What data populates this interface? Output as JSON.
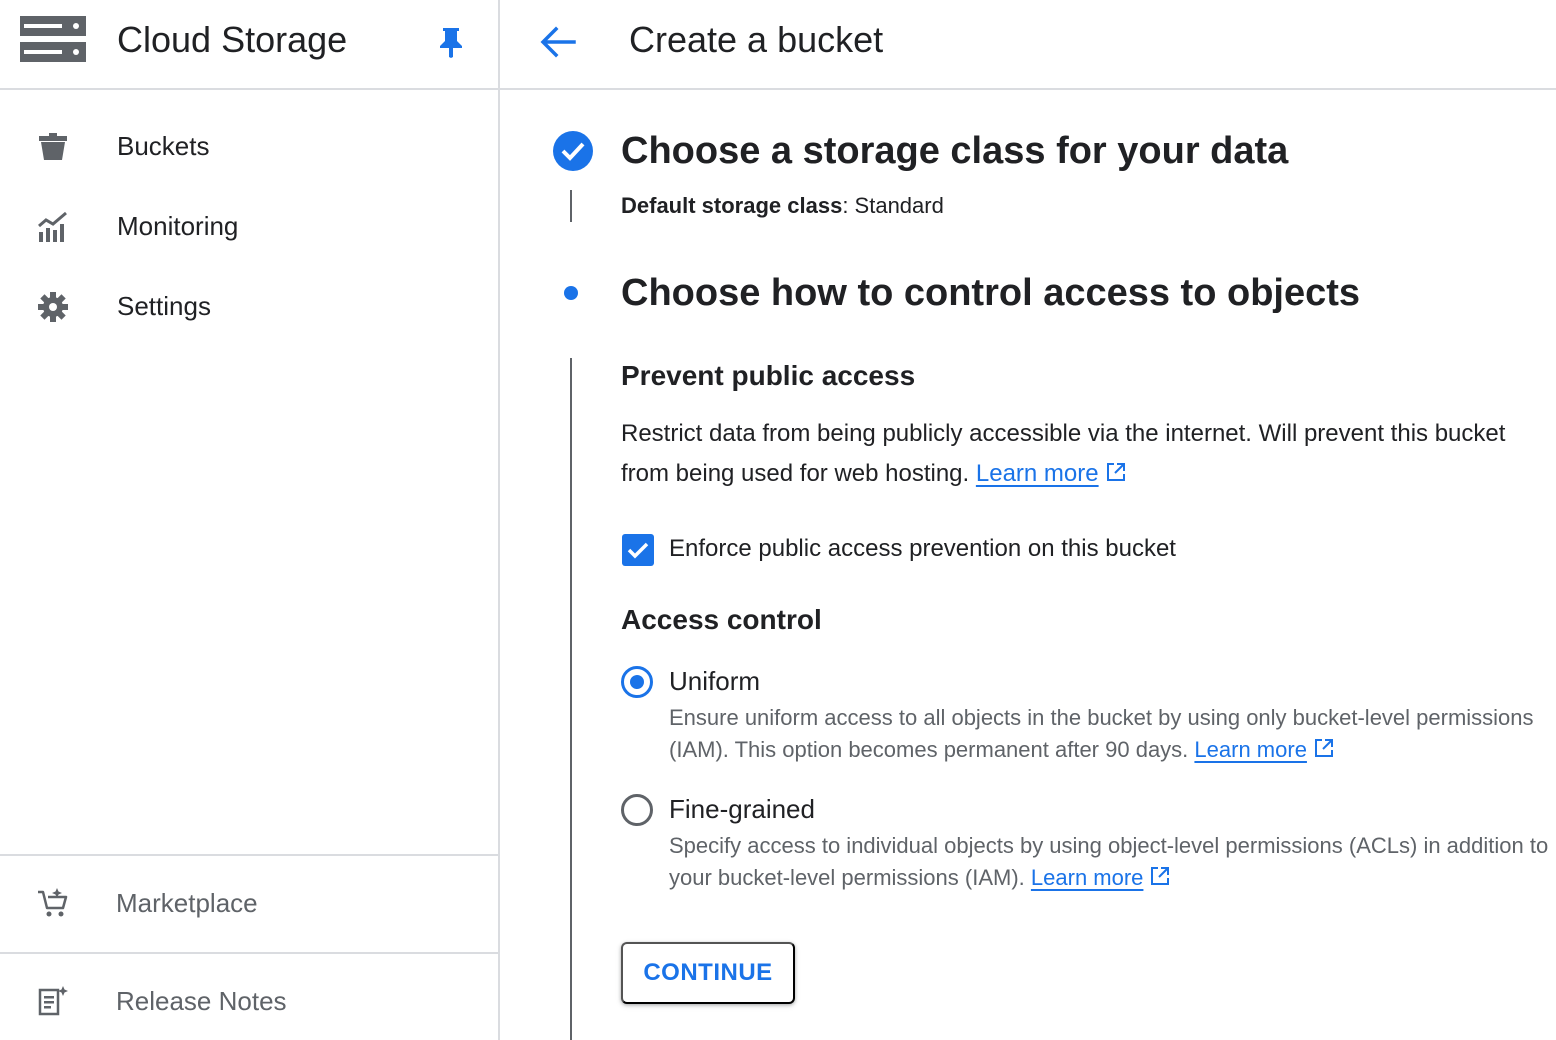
{
  "sidebar": {
    "product_title": "Cloud Storage",
    "logo_icon": "storage-logo-icon",
    "pin_icon": "pin-icon",
    "items": [
      {
        "label": "Buckets",
        "icon": "bucket-icon"
      },
      {
        "label": "Monitoring",
        "icon": "monitoring-icon"
      },
      {
        "label": "Settings",
        "icon": "gear-icon"
      }
    ],
    "bottom_items": [
      {
        "label": "Marketplace",
        "icon": "marketplace-cart-icon"
      },
      {
        "label": "Release Notes",
        "icon": "release-notes-icon"
      }
    ]
  },
  "header": {
    "back_icon": "arrow-back-icon",
    "page_title": "Create a bucket"
  },
  "steps": {
    "step1": {
      "title": "Choose a storage class for your data",
      "summary_label": "Default storage class",
      "summary_separator": ": ",
      "summary_value": "Standard",
      "status_icon": "check-circle-icon"
    },
    "step2": {
      "title": "Choose how to control access to objects"
    }
  },
  "public_access": {
    "title": "Prevent public access",
    "description": "Restrict data from being publicly accessible via the internet. Will prevent this bucket from being used for web hosting.",
    "learn_more": "Learn more",
    "checkbox_label": "Enforce public access prevention on this bucket",
    "checkbox_checked": true
  },
  "access_control": {
    "title": "Access control",
    "options": [
      {
        "label": "Uniform",
        "description": "Ensure uniform access to all objects in the bucket by using only bucket-level permissions (IAM). This option becomes permanent after 90 days.",
        "learn_more": "Learn more",
        "selected": true
      },
      {
        "label": "Fine-grained",
        "description": "Specify access to individual objects by using object-level permissions (ACLs) in addition to your bucket-level permissions (IAM).",
        "learn_more": "Learn more",
        "selected": false
      }
    ]
  },
  "actions": {
    "continue_label": "CONTINUE"
  },
  "colors": {
    "accent": "#1a73e8",
    "text": "#202124",
    "secondary_text": "#5f6368",
    "divider": "#dadce0"
  }
}
